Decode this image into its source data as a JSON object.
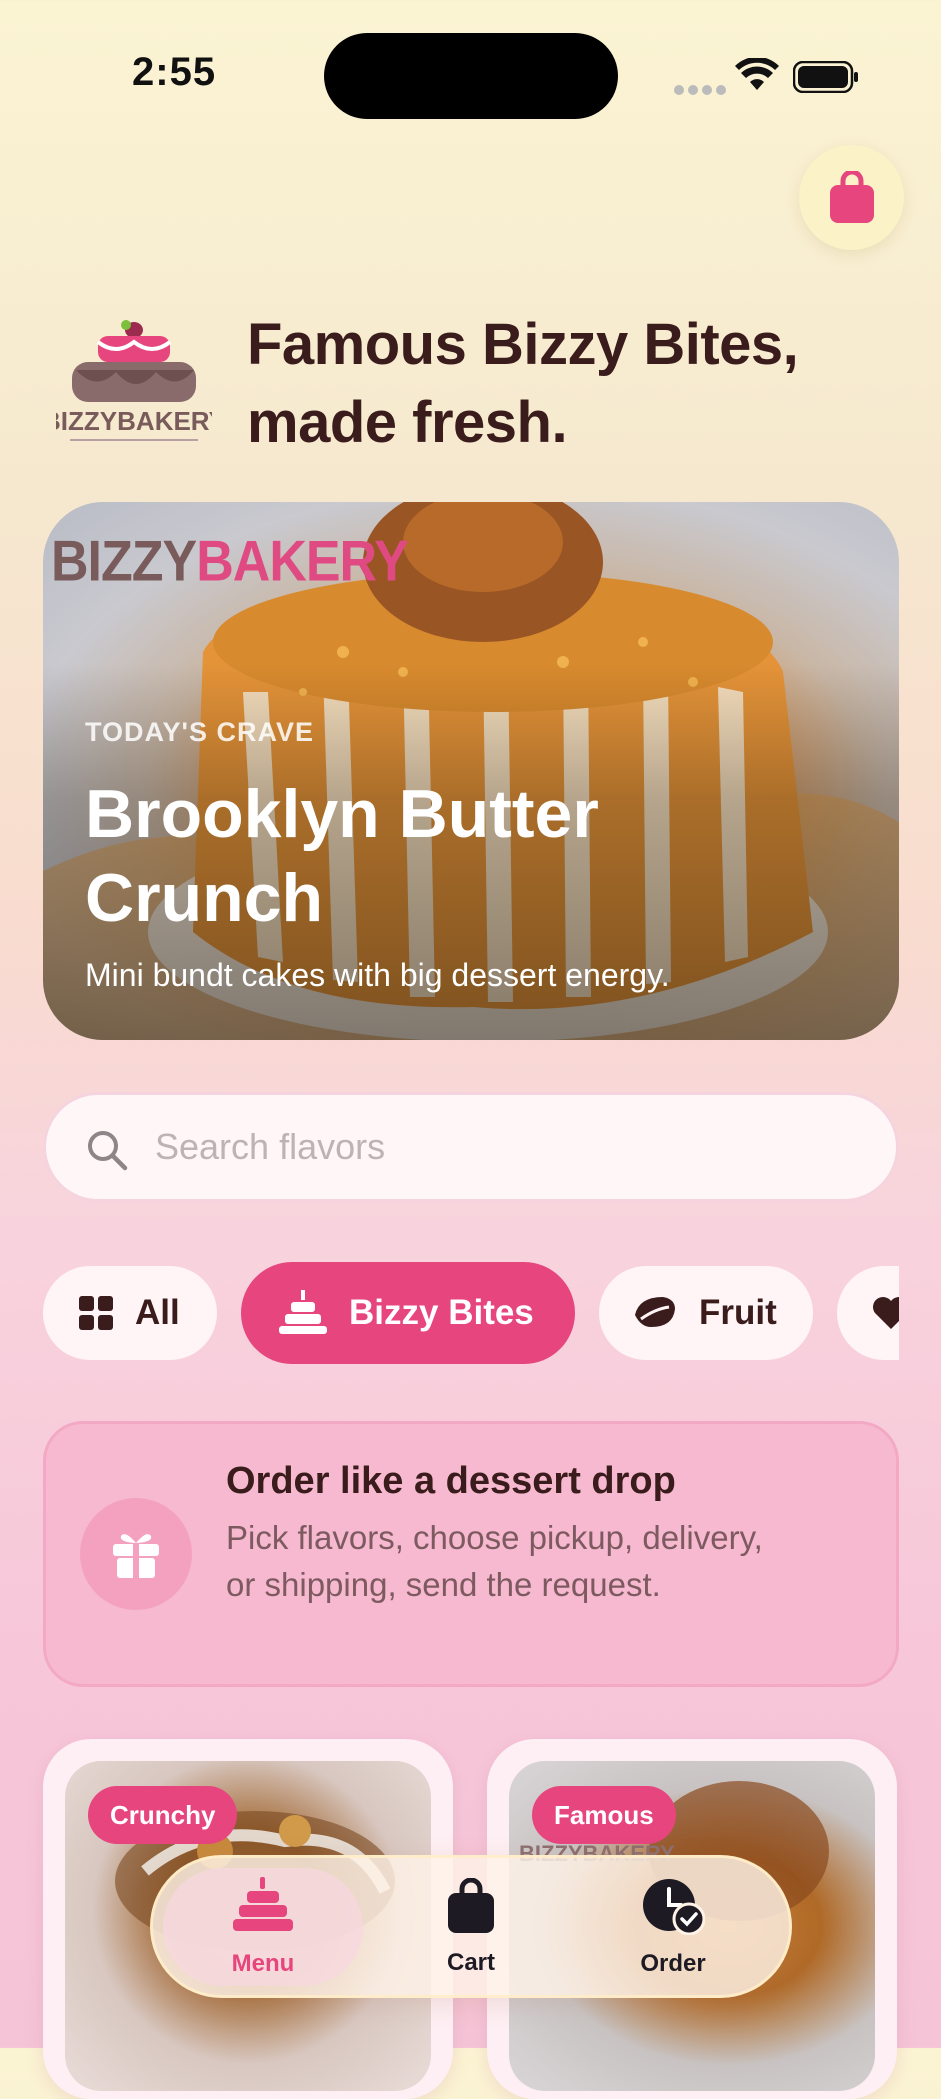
{
  "status_bar": {
    "time": "2:55"
  },
  "header": {
    "logo_text": "BIZZYBAKERY",
    "headline": "Famous Bizzy Bites, made fresh."
  },
  "hero": {
    "brand_part1": "BIZZY",
    "brand_part2": "BAKERY",
    "eyebrow": "TODAY'S CRAVE",
    "title": "Brooklyn Butter Crunch",
    "subtitle": "Mini bundt cakes with big dessert energy."
  },
  "search": {
    "placeholder": "Search flavors"
  },
  "categories": [
    {
      "label": "All",
      "icon": "grid-icon",
      "active": false
    },
    {
      "label": "Bizzy Bites",
      "icon": "cake-icon",
      "active": true
    },
    {
      "label": "Fruit",
      "icon": "leaf-icon",
      "active": false
    },
    {
      "label": "",
      "icon": "heart-icon",
      "active": false
    }
  ],
  "promo": {
    "title": "Order like a dessert drop",
    "body": "Pick flavors, choose pickup, delivery, or shipping, send the request.",
    "icon": "gift-icon"
  },
  "products": [
    {
      "badge": "Crunchy"
    },
    {
      "badge": "Famous"
    }
  ],
  "tabbar": {
    "items": [
      {
        "label": "Menu",
        "icon": "cake-icon",
        "active": true
      },
      {
        "label": "Cart",
        "icon": "bag-icon",
        "active": false
      },
      {
        "label": "Order",
        "icon": "clock-check-icon",
        "active": false
      }
    ]
  },
  "colors": {
    "accent": "#e6457e",
    "text_dark": "#3a1c1c",
    "promo_bg": "#f6b9cf"
  }
}
